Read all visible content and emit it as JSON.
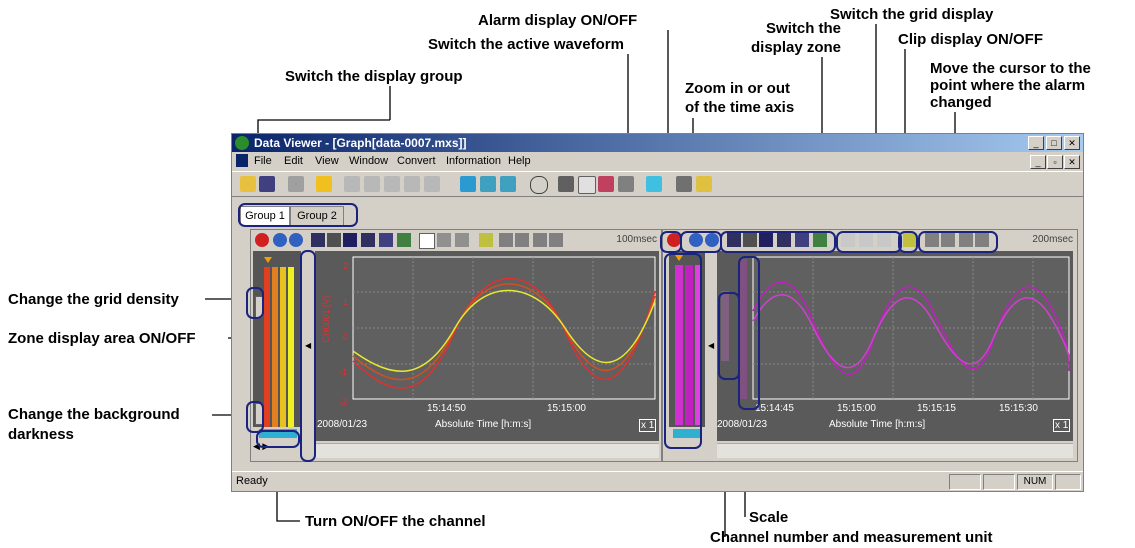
{
  "window": {
    "title": "Data Viewer - [Graph[data-0007.mxs]]",
    "menu": [
      "File",
      "Edit",
      "View",
      "Window",
      "Convert",
      "Information",
      "Help"
    ],
    "status_ready": "Ready",
    "status_num": "NUM"
  },
  "groups": [
    "Group 1",
    "Group 2"
  ],
  "left_pane": {
    "rate": "100msec",
    "date": "2008/01/23",
    "xlabel": "Absolute Time [h:m:s]",
    "ticks": [
      "15:14:50",
      "15:15:00"
    ],
    "yticks": [
      "2",
      "1",
      "0",
      "-1",
      "-2"
    ],
    "channel_label": "CH0001 [V]",
    "zoom": "x 1"
  },
  "right_pane": {
    "rate": "200msec",
    "date": "2008/01/23",
    "xlabel": "Absolute Time [h:m:s]",
    "ticks": [
      "15:14:45",
      "15:15:00",
      "15:15:15",
      "15:15:30"
    ],
    "zoom": "x 1"
  },
  "callouts": {
    "alarm": "Alarm display ON/OFF",
    "active_wave": "Switch the active waveform",
    "display_group": "Switch the display group",
    "zoom_time": "Zoom in or out\nof the time axis",
    "display_zone": "Switch the\ndisplay zone",
    "grid_display": "Switch the grid display",
    "clip": "Clip display ON/OFF",
    "cursor_alarm": "Move the cursor to the\npoint where the alarm\nchanged",
    "grid_density": "Change the grid density",
    "zone_area": "Zone display area ON/OFF",
    "bg_darkness": "Change the background\ndarkness",
    "channel_onoff": "Turn ON/OFF the channel",
    "scale": "Scale",
    "channel_unit": "Channel number and measurement unit"
  },
  "colors": {
    "title_start": "#0a246a",
    "wave_red": "#e03030",
    "wave_yellow": "#e8e830",
    "wave_purple": "#c020c0",
    "callout_line": "#000000"
  }
}
